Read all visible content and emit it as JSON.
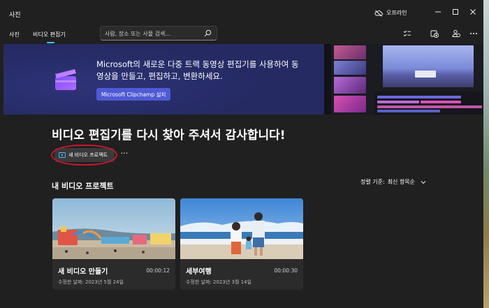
{
  "app": {
    "title": "사진",
    "status": "오프라인"
  },
  "nav": {
    "items": [
      {
        "label": "사진"
      },
      {
        "label": "비디오 편집기"
      }
    ],
    "search_placeholder": "사람, 장소 또는 사물 검색..."
  },
  "banner": {
    "text": "Microsoft의 새로운 다중 트랙 동영상 편집기를 사용하여 동영상을 만들고, 편집하고, 변환하세요.",
    "cta": "Microsoft Clipchamp 설치"
  },
  "main": {
    "heading": "비디오 편집기를 다시 찾아 주셔서 감사합니다!",
    "new_project_label": "새 비디오 프로젝트",
    "more_label": "···",
    "section_title": "내 비디오 프로젝트",
    "sort_label": "정렬 기준:",
    "sort_value": "최신 항목순"
  },
  "projects": [
    {
      "title": "새 비디오 만들기",
      "duration": "00:00:12",
      "date": "수정한 날짜: 2023년 5월 24일"
    },
    {
      "title": "세부여행",
      "duration": "00:00:30",
      "date": "수정한 날짜: 2023년 3월 14일"
    }
  ],
  "colors": {
    "accent": "#4cc2ff",
    "banner_bg": "#252a63",
    "cta_bg": "#4f5bd5",
    "annotation": "#c8162c"
  },
  "icons": [
    "offline-icon",
    "minimize-icon",
    "maximize-icon",
    "close-icon",
    "search-icon",
    "select-icon",
    "import-icon",
    "people-icon",
    "more-icon",
    "clipchamp-logo-icon",
    "video-project-icon",
    "chevron-down-icon"
  ]
}
